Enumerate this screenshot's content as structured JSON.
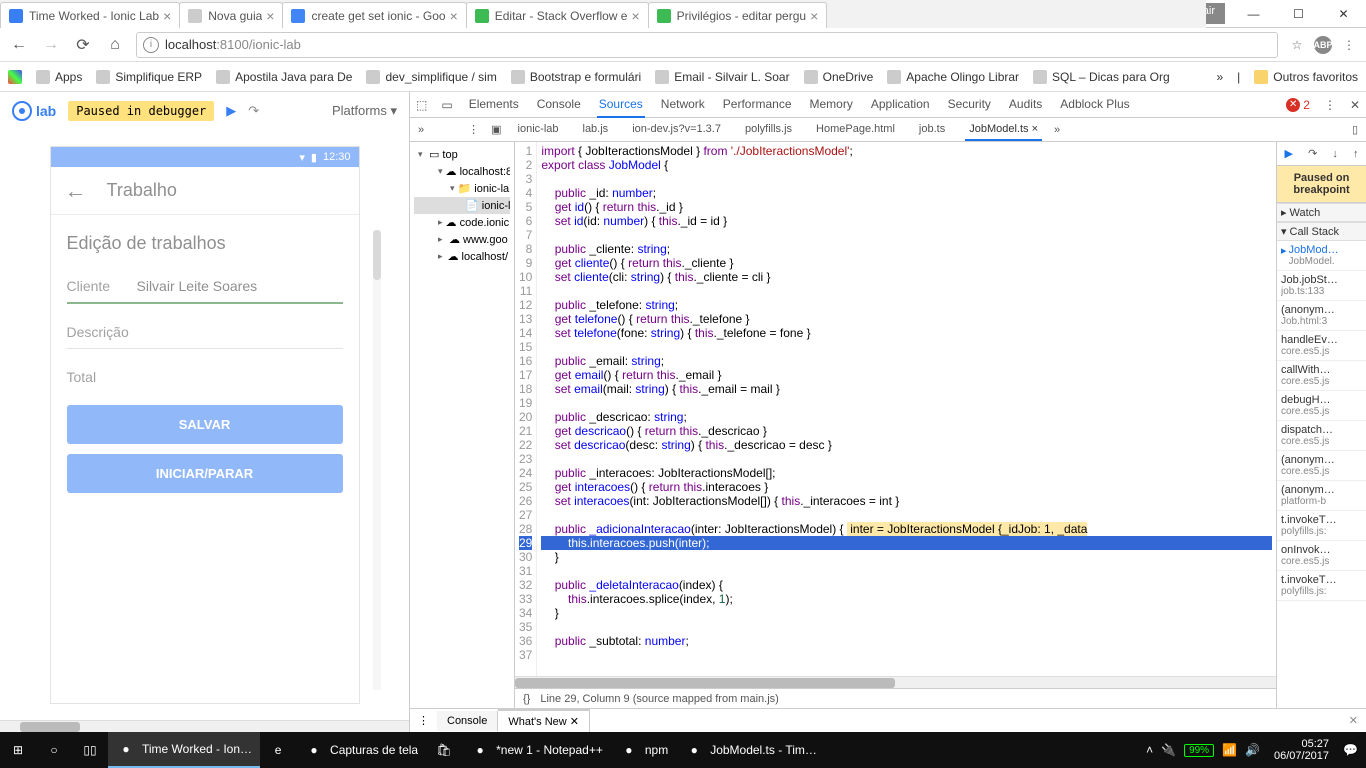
{
  "window": {
    "user": "Silvair",
    "tabs": [
      {
        "title": "Time Worked - Ionic Lab",
        "active": true,
        "favicon_color": "#387ef5"
      },
      {
        "title": "Nova guia",
        "favicon_color": "#ccc"
      },
      {
        "title": "create get set ionic - Goo",
        "favicon_color": "#4285f4"
      },
      {
        "title": "Editar - Stack Overflow e",
        "favicon_color": "#3cba54"
      },
      {
        "title": "Privilégios - editar pergu",
        "favicon_color": "#3cba54"
      }
    ],
    "url_host": "localhost",
    "url_port": ":8100",
    "url_path": "/ionic-lab"
  },
  "bookmarks": [
    {
      "label": "Apps"
    },
    {
      "label": "Simplifique ERP"
    },
    {
      "label": "Apostila Java para De"
    },
    {
      "label": "dev_simplifique / sim"
    },
    {
      "label": "Bootstrap e formulári"
    },
    {
      "label": "Email - Silvair L. Soar"
    },
    {
      "label": "OneDrive"
    },
    {
      "label": "Apache Olingo Librar"
    },
    {
      "label": "SQL – Dicas para Org"
    }
  ],
  "bookmarks_more": "»",
  "bookmarks_other": "Outros favoritos",
  "ionic": {
    "logo": "lab",
    "paused": "Paused in debugger",
    "platforms": "Platforms",
    "app_title": "Trabalho",
    "statusbar_time": "12:30",
    "form_title": "Edição de trabalhos",
    "fields": {
      "cliente_label": "Cliente",
      "cliente_value": "Silvair Leite Soares",
      "descricao_label": "Descrição",
      "total_label": "Total"
    },
    "btn_salvar": "SALVAR",
    "btn_iniciar": "INICIAR/PARAR"
  },
  "devtools": {
    "tabs": [
      "Elements",
      "Console",
      "Sources",
      "Network",
      "Performance",
      "Memory",
      "Application",
      "Security",
      "Audits",
      "Adblock Plus"
    ],
    "active_tab": "Sources",
    "error_count": "2",
    "tree": {
      "top": "top",
      "items": [
        {
          "label": "localhost:8",
          "indent": 1,
          "expanded": true,
          "type": "cloud"
        },
        {
          "label": "ionic-la",
          "indent": 2,
          "expanded": true,
          "type": "folder"
        },
        {
          "label": "ionic-la",
          "indent": 3,
          "selected": true,
          "type": "file"
        },
        {
          "label": "code.ionic",
          "indent": 1,
          "type": "cloud"
        },
        {
          "label": "www.goo",
          "indent": 1,
          "type": "cloud"
        },
        {
          "label": "localhost/",
          "indent": 1,
          "type": "cloud"
        }
      ]
    },
    "file_tabs": [
      "ionic-lab",
      "lab.js",
      "ion-dev.js?v=1.3.7",
      "polyfills.js",
      "HomePage.html",
      "job.ts",
      "JobModel.ts"
    ],
    "active_file": "JobModel.ts",
    "code_status": "Line 29, Column 9   (source mapped from main.js)",
    "paused_label": "Paused on breakpoint",
    "right_sections": {
      "watch": "Watch",
      "callstack": "Call Stack"
    },
    "callstack": [
      {
        "fn": "JobMod…",
        "loc": "JobModel.",
        "active": true
      },
      {
        "fn": "Job.jobSt…",
        "loc": "job.ts:133"
      },
      {
        "fn": "(anonym…",
        "loc": "Job.html:3"
      },
      {
        "fn": "handleEv…",
        "loc": "core.es5.js"
      },
      {
        "fn": "callWith…",
        "loc": "core.es5.js"
      },
      {
        "fn": "debugH…",
        "loc": "core.es5.js"
      },
      {
        "fn": "dispatch…",
        "loc": "core.es5.js"
      },
      {
        "fn": "(anonym…",
        "loc": "core.es5.js"
      },
      {
        "fn": "(anonym…",
        "loc": "platform-b"
      },
      {
        "fn": "t.invokeT…",
        "loc": "polyfills.js:"
      },
      {
        "fn": "onInvok…",
        "loc": "core.es5.js"
      },
      {
        "fn": "t.invokeT…",
        "loc": "polyfills.js:"
      }
    ],
    "drawer": {
      "console": "Console",
      "whatsnew": "What's New"
    }
  },
  "code": {
    "lines": [
      {
        "n": 1,
        "html": "<span class='kw'>import</span> { JobIteractionsModel } <span class='kw'>from</span> <span class='str'>'./JobIteractionsModel'</span>;"
      },
      {
        "n": 2,
        "html": "<span class='kw'>export</span> <span class='kw'>class</span> <span class='fn'>JobModel</span> {"
      },
      {
        "n": 3,
        "html": ""
      },
      {
        "n": 4,
        "html": "    <span class='kw'>public</span> _id: <span class='fn'>number</span>;"
      },
      {
        "n": 5,
        "html": "    <span class='kw'>get</span> <span class='fn'>id</span>() { <span class='kw'>return</span> <span class='kw'>this</span>._id }"
      },
      {
        "n": 6,
        "html": "    <span class='kw'>set</span> <span class='fn'>id</span>(id: <span class='fn'>number</span>) { <span class='kw'>this</span>._id = id }"
      },
      {
        "n": 7,
        "html": ""
      },
      {
        "n": 8,
        "html": "    <span class='kw'>public</span> _cliente: <span class='fn'>string</span>;"
      },
      {
        "n": 9,
        "html": "    <span class='kw'>get</span> <span class='fn'>cliente</span>() { <span class='kw'>return</span> <span class='kw'>this</span>._cliente }"
      },
      {
        "n": 10,
        "html": "    <span class='kw'>set</span> <span class='fn'>cliente</span>(cli: <span class='fn'>string</span>) { <span class='kw'>this</span>._cliente = cli }"
      },
      {
        "n": 11,
        "html": ""
      },
      {
        "n": 12,
        "html": "    <span class='kw'>public</span> _telefone: <span class='fn'>string</span>;"
      },
      {
        "n": 13,
        "html": "    <span class='kw'>get</span> <span class='fn'>telefone</span>() { <span class='kw'>return</span> <span class='kw'>this</span>._telefone }"
      },
      {
        "n": 14,
        "html": "    <span class='kw'>set</span> <span class='fn'>telefone</span>(fone: <span class='fn'>string</span>) { <span class='kw'>this</span>._telefone = fone }"
      },
      {
        "n": 15,
        "html": ""
      },
      {
        "n": 16,
        "html": "    <span class='kw'>public</span> _email: <span class='fn'>string</span>;"
      },
      {
        "n": 17,
        "html": "    <span class='kw'>get</span> <span class='fn'>email</span>() { <span class='kw'>return</span> <span class='kw'>this</span>._email }"
      },
      {
        "n": 18,
        "html": "    <span class='kw'>set</span> <span class='fn'>email</span>(mail: <span class='fn'>string</span>) { <span class='kw'>this</span>._email = mail }"
      },
      {
        "n": 19,
        "html": ""
      },
      {
        "n": 20,
        "html": "    <span class='kw'>public</span> _descricao: <span class='fn'>string</span>;"
      },
      {
        "n": 21,
        "html": "    <span class='kw'>get</span> <span class='fn'>descricao</span>() { <span class='kw'>return</span> <span class='kw'>this</span>._descricao }"
      },
      {
        "n": 22,
        "html": "    <span class='kw'>set</span> <span class='fn'>descricao</span>(desc: <span class='fn'>string</span>) { <span class='kw'>this</span>._descricao = desc }"
      },
      {
        "n": 23,
        "html": ""
      },
      {
        "n": 24,
        "html": "    <span class='kw'>public</span> _interacoes: JobIteractionsModel[];"
      },
      {
        "n": 25,
        "html": "    <span class='kw'>get</span> <span class='fn'>interacoes</span>() { <span class='kw'>return</span> <span class='kw'>this</span>.interacoes }"
      },
      {
        "n": 26,
        "html": "    <span class='kw'>set</span> <span class='fn'>interacoes</span>(int: JobIteractionsModel[]) { <span class='kw'>this</span>._interacoes = int }"
      },
      {
        "n": 27,
        "html": ""
      },
      {
        "n": 28,
        "html": "    <span class='kw'>public</span> <span class='fn'>_adicionaInteracao</span>(inter: JobIteractionsModel) { <span class='hl-yellow'> inter = JobIteractionsModel {_idJob: 1, _data</span>",
        "cls": ""
      },
      {
        "n": 29,
        "html": "        <span class='kw'>this</span>.interacoes.push(inter);",
        "cls": "hl-blue",
        "current": true
      },
      {
        "n": 30,
        "html": "    }"
      },
      {
        "n": 31,
        "html": ""
      },
      {
        "n": 32,
        "html": "    <span class='kw'>public</span> <span class='fn'>_deletaInteracao</span>(index) {"
      },
      {
        "n": 33,
        "html": "        <span class='kw'>this</span>.interacoes.splice(index, <span class='num2'>1</span>);"
      },
      {
        "n": 34,
        "html": "    }"
      },
      {
        "n": 35,
        "html": ""
      },
      {
        "n": 36,
        "html": "    <span class='kw'>public</span> _subtotal: <span class='fn'>number</span>;"
      },
      {
        "n": 37,
        "html": ""
      }
    ]
  },
  "taskbar": {
    "items": [
      {
        "label": "Time Worked - Ion…",
        "color": "#fff"
      },
      {
        "label": "",
        "icon": "edge"
      },
      {
        "label": "Capturas de tela"
      },
      {
        "label": "",
        "icon": "store"
      },
      {
        "label": "*new 1 - Notepad++"
      },
      {
        "label": "npm"
      },
      {
        "label": "JobModel.ts - Tim…"
      }
    ],
    "battery": "99%",
    "time": "05:27",
    "date": "06/07/2017"
  }
}
